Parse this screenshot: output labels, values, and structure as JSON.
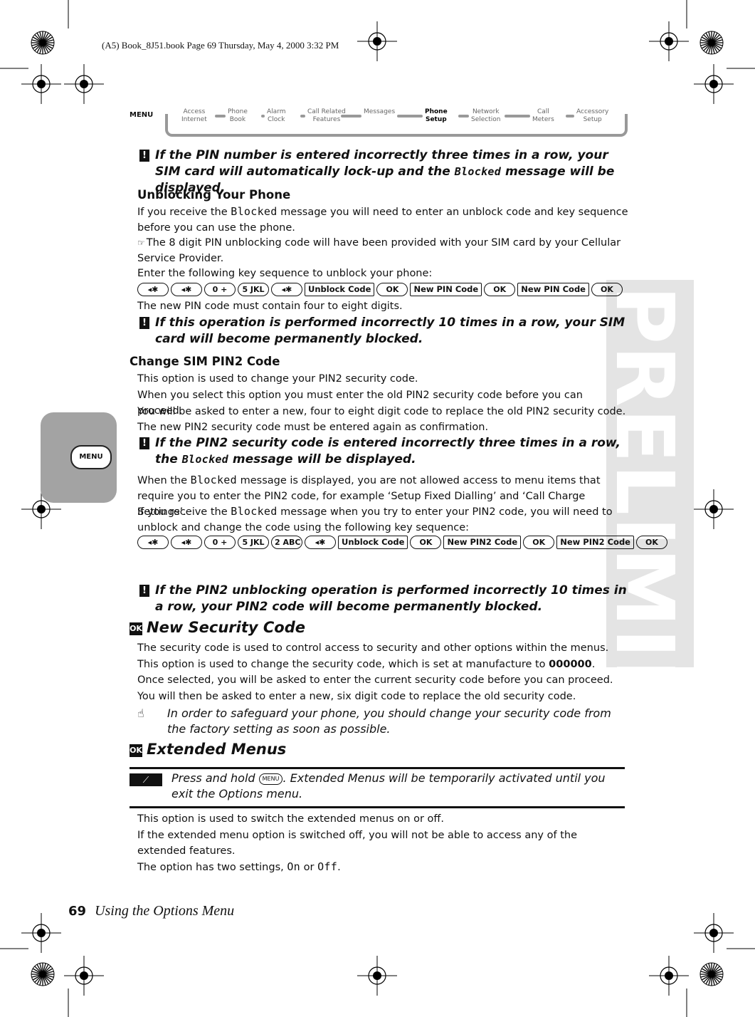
{
  "header": "(A5) Book_8J51.book  Page 69  Thursday, May 4, 2000  3:32 PM",
  "nav": {
    "menu": "MENU",
    "items": [
      {
        "l1": "Access",
        "l2": "Internet",
        "active": false
      },
      {
        "l1": "Phone",
        "l2": "Book",
        "active": false
      },
      {
        "l1": "Alarm",
        "l2": "Clock",
        "active": false
      },
      {
        "l1": "Call Related",
        "l2": "Features",
        "active": false
      },
      {
        "l1": "Messages",
        "l2": "",
        "active": false
      },
      {
        "l1": "Phone",
        "l2": "Setup",
        "active": true
      },
      {
        "l1": "Network",
        "l2": "Selection",
        "active": false
      },
      {
        "l1": "Call",
        "l2": "Meters",
        "active": false
      },
      {
        "l1": "Accessory",
        "l2": "Setup",
        "active": false
      }
    ]
  },
  "side_tab": "MENU",
  "watermark": "PRELIMINARY",
  "blocks": [
    {
      "type": "warn",
      "text": [
        "If the PIN number is entered incorrectly three times in a row, your SIM card will automatically lock-up and the ",
        {
          "mono": "Blocked"
        },
        " message will be displayed."
      ]
    },
    {
      "type": "h3",
      "text": [
        "Unblocking Your Phone"
      ]
    },
    {
      "type": "p",
      "text": [
        "If you receive the ",
        {
          "mono": "Blocked"
        },
        " message you will need to enter an unblock code and key sequence before you can use the phone."
      ]
    },
    {
      "type": "note",
      "text": [
        "The 8 digit PIN unblocking code will have been provided with your SIM card by your Cellular Service Provider."
      ]
    },
    {
      "type": "p",
      "text": [
        "Enter the following key sequence to unblock your phone:"
      ]
    },
    {
      "type": "keys",
      "keys": [
        {
          "k": "◂✱"
        },
        {
          "k": "◂✱"
        },
        {
          "k": "0 +"
        },
        {
          "k": "5 JKL"
        },
        {
          "k": "◂✱"
        },
        {
          "b": "Unblock Code"
        },
        {
          "k": "OK"
        },
        {
          "b": "New PIN Code"
        },
        {
          "k": "OK"
        },
        {
          "b": "New PIN Code"
        },
        {
          "k": "OK"
        }
      ]
    },
    {
      "type": "p",
      "text": [
        "The new PIN code must contain four to eight digits."
      ]
    },
    {
      "type": "warn",
      "text": [
        "If this operation is performed incorrectly 10 times in a row, your SIM card will become permanently blocked."
      ]
    },
    {
      "type": "h3",
      "text": [
        "Change SIM PIN2 Code"
      ]
    },
    {
      "type": "p",
      "text": [
        "This option is used to change your PIN2 security code."
      ]
    },
    {
      "type": "p",
      "text": [
        "When you select this option you must enter the old PIN2 security code before you can proceed."
      ]
    },
    {
      "type": "p",
      "text": [
        "You will be asked to enter a new, four to eight digit code to replace the old PIN2 security code. The new PIN2 security code must be entered again as confirmation."
      ]
    },
    {
      "type": "warn",
      "text": [
        "If the PIN2 security code is entered incorrectly three times in a row, the ",
        {
          "mono": "Blocked"
        },
        " message will be displayed."
      ]
    },
    {
      "type": "p",
      "text": [
        "When the ",
        {
          "mono": "Blocked"
        },
        " message is displayed, you are not allowed access to menu items that require you to enter the PIN2 code, for example ‘Setup Fixed Dialling’ and ‘Call Charge Settings’."
      ]
    },
    {
      "type": "p",
      "text": [
        "If you receive the ",
        {
          "mono": "Blocked"
        },
        " message when you try to enter your PIN2 code, you will need to unblock and change the code using the following key sequence:"
      ]
    },
    {
      "type": "keys",
      "keys": [
        {
          "k": "◂✱"
        },
        {
          "k": "◂✱"
        },
        {
          "k": "0 +"
        },
        {
          "k": "5 JKL"
        },
        {
          "k": "2 ABC"
        },
        {
          "k": "◂✱"
        },
        {
          "b": "Unblock Code"
        },
        {
          "k": "OK"
        },
        {
          "b": "New PIN2 Code"
        },
        {
          "k": "OK"
        },
        {
          "b": "New PIN2 Code"
        },
        {
          "k": "OK"
        }
      ]
    },
    {
      "type": "warn",
      "text": [
        "If the PIN2 unblocking operation is performed incorrectly 10 times in a row, your PIN2 code will become permanently blocked."
      ]
    },
    {
      "type": "h2",
      "text": [
        "New Security Code"
      ]
    },
    {
      "type": "p",
      "text": [
        "The security code is used to control access to security and other options within the menus."
      ]
    },
    {
      "type": "p",
      "text": [
        "This option is used to change the security code, which is set at manufacture to ",
        {
          "bold": "000000"
        },
        "."
      ]
    },
    {
      "type": "p",
      "text": [
        "Once selected, you will be asked to enter the current security code before you can proceed."
      ]
    },
    {
      "type": "p",
      "text": [
        "You will then be asked to enter a new, six digit code to replace the old security code."
      ]
    },
    {
      "type": "tip",
      "text": [
        "In order to safeguard your phone, you should change your security code from the factory setting as soon as possible."
      ]
    },
    {
      "type": "h2",
      "text": [
        "Extended Menus"
      ]
    },
    {
      "type": "short",
      "text": [
        "Press and hold ",
        {
          "key": "MENU"
        },
        ". Extended Menus will be temporarily activated until you exit the Options menu."
      ]
    },
    {
      "type": "p",
      "text": [
        "This option is used to switch the extended menus on or off."
      ]
    },
    {
      "type": "p",
      "text": [
        "If the extended menu option is switched off, you will not be able to access any of the extended features."
      ]
    },
    {
      "type": "p",
      "text": [
        "The option has two settings, ",
        {
          "mono": "On"
        },
        " or ",
        {
          "mono": "Off"
        },
        "."
      ]
    }
  ],
  "footer": {
    "page": "69",
    "title": "Using the Options Menu"
  }
}
